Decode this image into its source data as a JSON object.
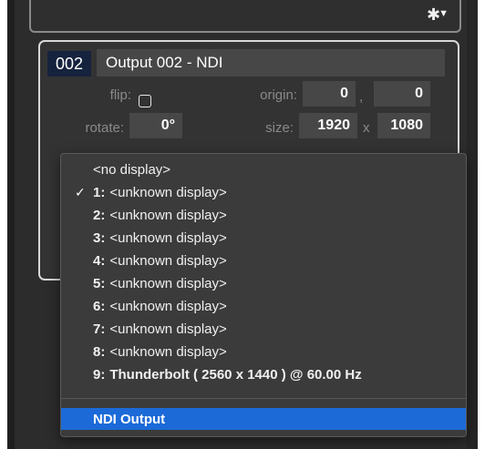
{
  "top_panel": {
    "gear_icon": "gear-icon",
    "caret_icon": "chevron-down-icon"
  },
  "output": {
    "id": "002",
    "name": "Output 002 - NDI",
    "flip_label": "flip:",
    "origin_label": "origin:",
    "origin_x": "0",
    "origin_sep": ",",
    "origin_y": "0",
    "rotate_label": "rotate:",
    "rotate_value": "0°",
    "size_label": "size:",
    "size_w": "1920",
    "size_sep": "x",
    "size_h": "1080"
  },
  "menu": {
    "items": [
      {
        "num": "",
        "text": "<no display>",
        "checked": false
      },
      {
        "num": "1:",
        "text": "<unknown display>",
        "checked": true
      },
      {
        "num": "2:",
        "text": "<unknown display>",
        "checked": false
      },
      {
        "num": "3:",
        "text": "<unknown display>",
        "checked": false
      },
      {
        "num": "4:",
        "text": "<unknown display>",
        "checked": false
      },
      {
        "num": "5:",
        "text": "<unknown display>",
        "checked": false
      },
      {
        "num": "6:",
        "text": "<unknown display>",
        "checked": false
      },
      {
        "num": "7:",
        "text": "<unknown display>",
        "checked": false
      },
      {
        "num": "8:",
        "text": "<unknown display>",
        "checked": false
      },
      {
        "num": "9:",
        "text": "Thunderbolt ( 2560 x 1440 ) @ 60.00 Hz",
        "checked": false
      }
    ],
    "selected": {
      "text": "NDI Output"
    },
    "check_mark": "✓"
  }
}
